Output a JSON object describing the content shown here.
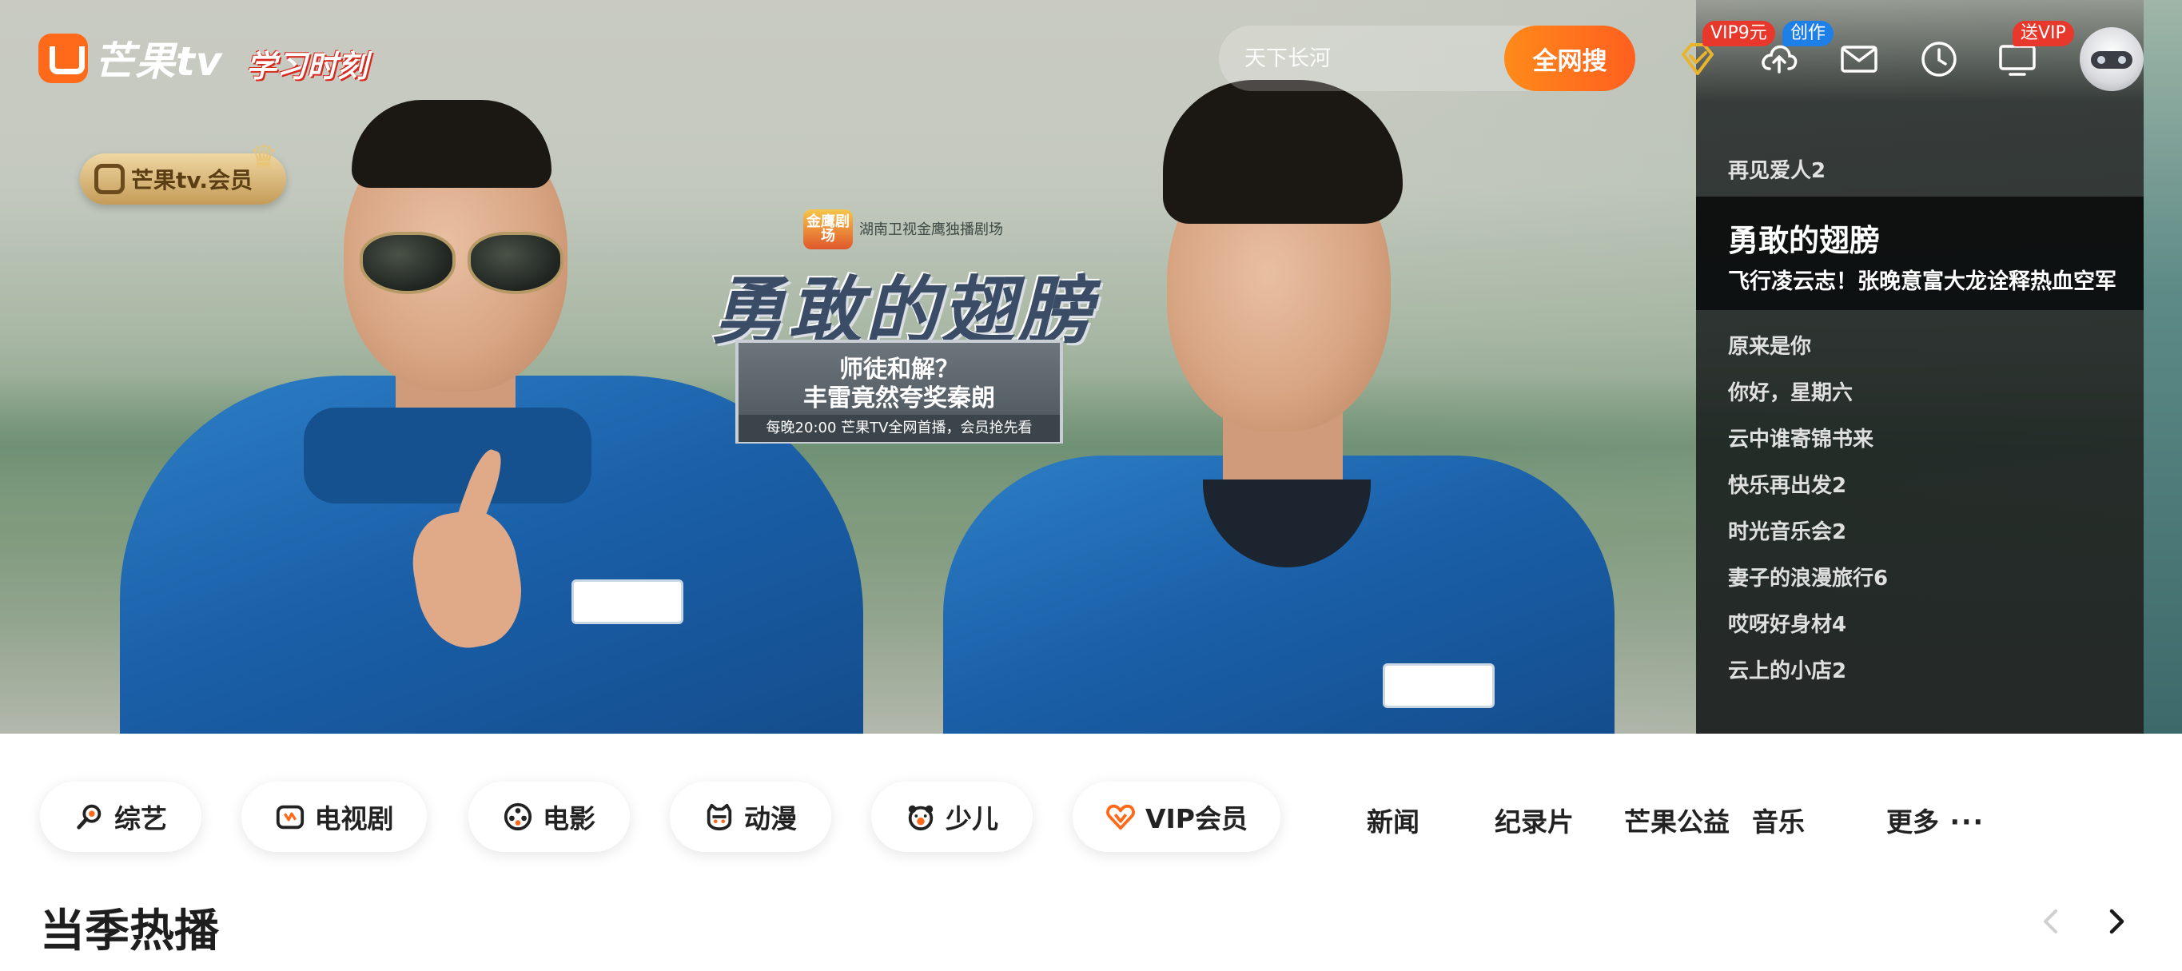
{
  "brand": {
    "name": "芒果tv",
    "slogan": "学习时刻",
    "member_badge": "芒果tv.会员",
    "accent": "#ff6a1a"
  },
  "search": {
    "placeholder": "天下长河",
    "button": "全网搜"
  },
  "header_icons": [
    {
      "name": "vip-diamond-icon",
      "badge": "VIP9元",
      "badge_color": "#e8382c"
    },
    {
      "name": "upload-icon",
      "badge": "创作",
      "badge_color": "#1e7fe6"
    },
    {
      "name": "mail-icon"
    },
    {
      "name": "history-clock-icon"
    },
    {
      "name": "tv-screen-icon",
      "badge": "送VIP",
      "badge_color": "#e8382c"
    },
    {
      "name": "user-avatar"
    }
  ],
  "hero": {
    "channel": "湖南卫视金鹰独播剧场",
    "jinying_label": "金鹰剧场",
    "title": "勇敢的翅膀",
    "box_line1": "师徒和解？",
    "box_line2": "丰雷竟然夸奖秦朗",
    "box_line3": "每晚20:00 芒果TV全网首播，会员抢先看"
  },
  "side_list": {
    "items": [
      {
        "label": "再见爱人2"
      },
      {
        "label": "勇敢的翅膀",
        "subtitle": "飞行凌云志！张晚意富大龙诠释热血空军",
        "active": true
      },
      {
        "label": "原来是你"
      },
      {
        "label": "你好，星期六"
      },
      {
        "label": "云中谁寄锦书来"
      },
      {
        "label": "快乐再出发2"
      },
      {
        "label": "时光音乐会2"
      },
      {
        "label": "妻子的浪漫旅行6"
      },
      {
        "label": "哎呀好身材4"
      },
      {
        "label": "云上的小店2"
      }
    ]
  },
  "nav": {
    "chips": [
      {
        "label": "综艺",
        "icon": "variety-icon"
      },
      {
        "label": "电视剧",
        "icon": "tv-drama-icon"
      },
      {
        "label": "电影",
        "icon": "film-reel-icon"
      },
      {
        "label": "动漫",
        "icon": "anime-icon"
      },
      {
        "label": "少儿",
        "icon": "kids-bear-icon"
      },
      {
        "label": "VIP会员",
        "icon": "vip-heart-icon"
      }
    ],
    "links": [
      "新闻",
      "纪录片",
      "芒果公益",
      "音乐"
    ],
    "more": "更多"
  },
  "section": {
    "title": "当季热播"
  }
}
